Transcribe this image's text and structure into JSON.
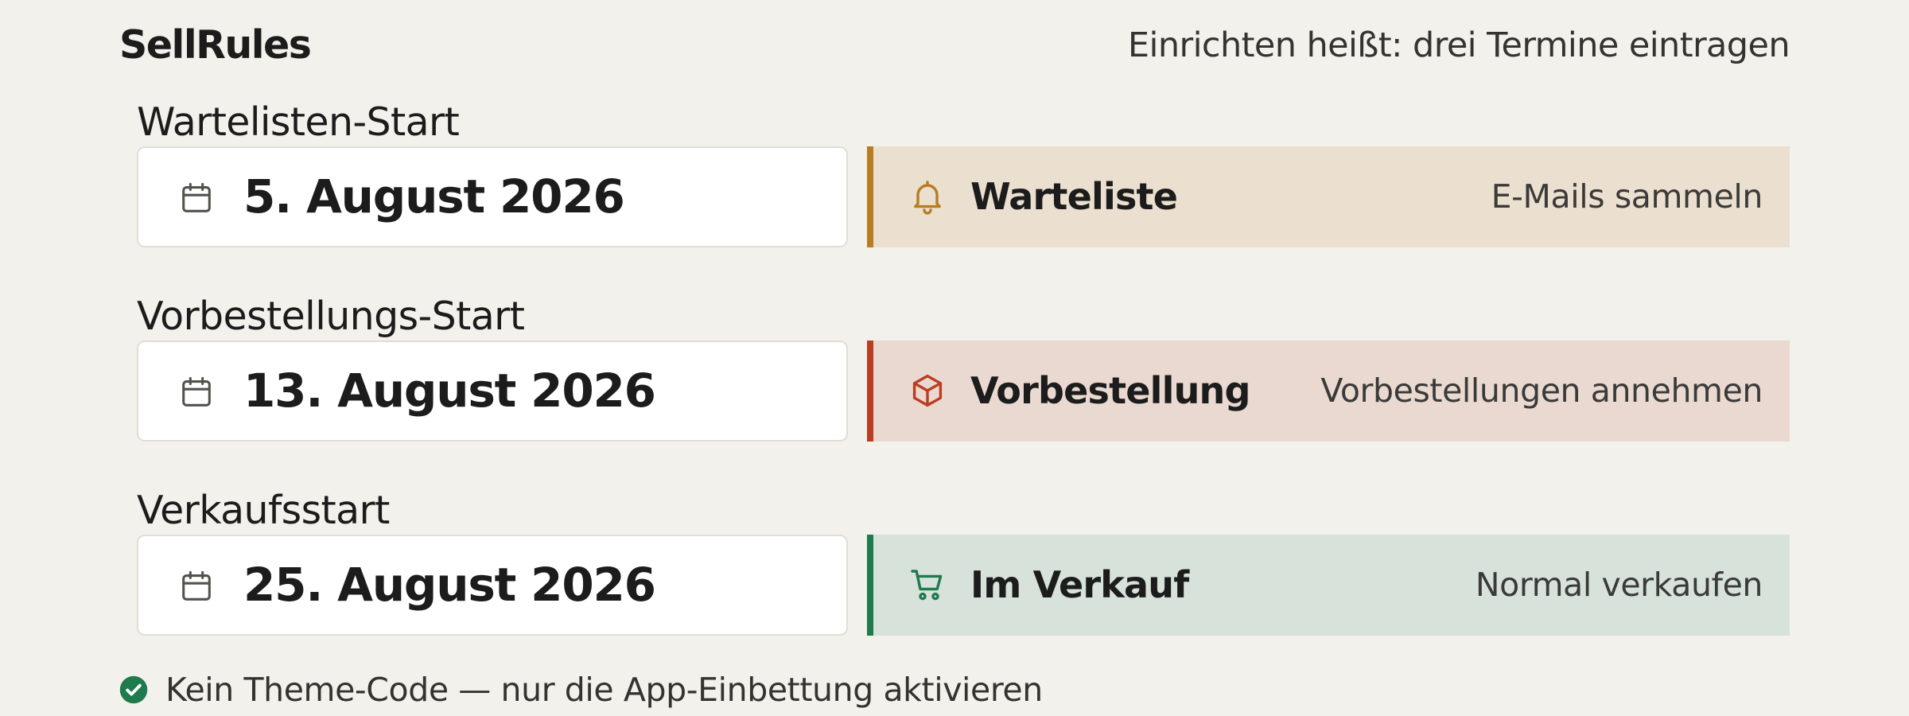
{
  "header": {
    "brand": "SellRules",
    "tagline": "Einrichten heißt: drei Termine eintragen"
  },
  "rows": [
    {
      "label": "Wartelisten-Start",
      "date": "5. August 2026",
      "date_icon": "calendar-icon",
      "phase": {
        "name": "Warteliste",
        "action": "E-Mails sammeln",
        "icon": "bell-icon",
        "accent": "#b87d22",
        "background": "#ebe0d0"
      }
    },
    {
      "label": "Vorbestellungs-Start",
      "date": "13. August 2026",
      "date_icon": "calendar-icon",
      "phase": {
        "name": "Vorbestellung",
        "action": "Vorbestellungen annehmen",
        "icon": "box-icon",
        "accent": "#bb3d24",
        "background": "#ead9d1"
      }
    },
    {
      "label": "Verkaufsstart",
      "date": "25. August 2026",
      "date_icon": "calendar-icon",
      "phase": {
        "name": "Im Verkauf",
        "action": "Normal verkaufen",
        "icon": "cart-icon",
        "accent": "#1f7a4d",
        "background": "#d6e2da"
      }
    }
  ],
  "footer": {
    "icon": "check-circle-icon",
    "icon_color": "#1f7a4d",
    "text": "Kein Theme-Code — nur die App-Einbettung aktivieren"
  }
}
